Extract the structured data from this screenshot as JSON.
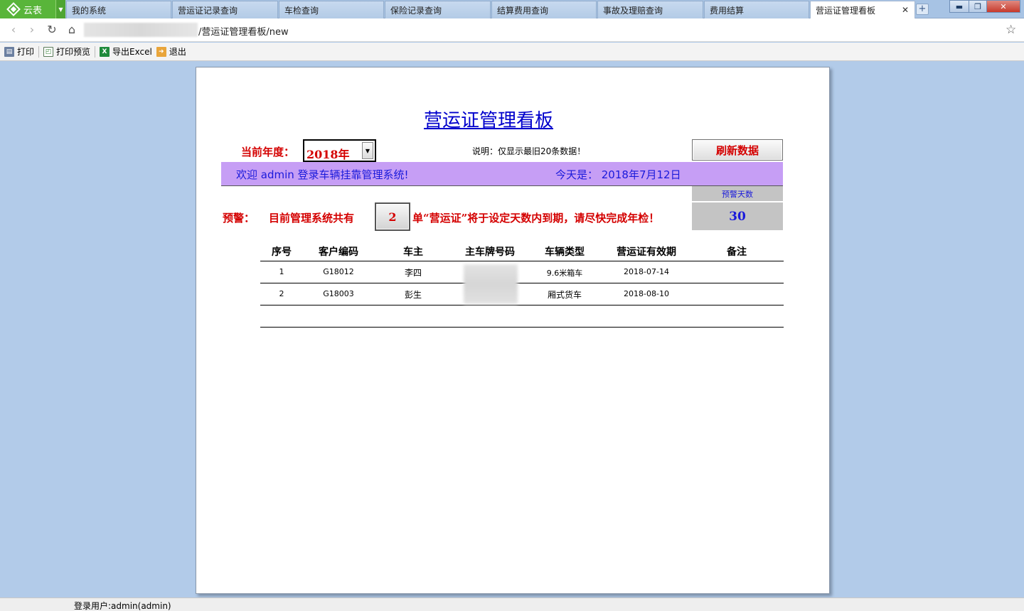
{
  "app": {
    "name": "云表"
  },
  "tabs": [
    {
      "label": "我的系统"
    },
    {
      "label": "营运证记录查询"
    },
    {
      "label": "车检查询"
    },
    {
      "label": "保险记录查询"
    },
    {
      "label": "结算费用查询"
    },
    {
      "label": "事故及理赔查询"
    },
    {
      "label": "费用结算"
    },
    {
      "label": "营运证管理看板",
      "active": true
    }
  ],
  "address": {
    "path": "/营运证管理看板/new"
  },
  "toolbar": {
    "print": "打印",
    "print_preview": "打印预览",
    "export_excel": "导出Excel",
    "exit": "退出"
  },
  "report": {
    "title": "营运证管理看板",
    "year_label": "当前年度：",
    "year_value": "2018年",
    "note": "说明：仅显示最旧20条数据！",
    "refresh_label": "刷新数据",
    "welcome_text": "欢迎 admin   登录车辆挂靠管理系统!",
    "today_text": "今天是：  2018年7月12日",
    "warn_days_label": "预警天数",
    "warn_days_value": "30",
    "warn_label": "预警：",
    "warn_pre": "目前管理系统共有",
    "warn_count": "2",
    "warn_post": "单“营运证”将于设定天数内到期，请尽快完成年检！"
  },
  "table": {
    "columns": [
      "序号",
      "客户编码",
      "车主",
      "主车牌号码",
      "车辆类型",
      "营运证有效期",
      "备注"
    ],
    "rows": [
      {
        "seq": "1",
        "code": "G18012",
        "owner": "李四",
        "type": "9.6米箱车",
        "valid": "2018-07-14",
        "remark": ""
      },
      {
        "seq": "2",
        "code": "G18003",
        "owner": "彭生",
        "type": "厢式货车",
        "valid": "2018-08-10",
        "remark": ""
      }
    ]
  },
  "status": {
    "user": "登录用户:admin(admin)"
  },
  "colors": {
    "accent_red": "#d40000",
    "accent_blue": "#1a1adb",
    "welcome_bg": "#c69ef5",
    "page_bg": "#b2cbe9"
  }
}
